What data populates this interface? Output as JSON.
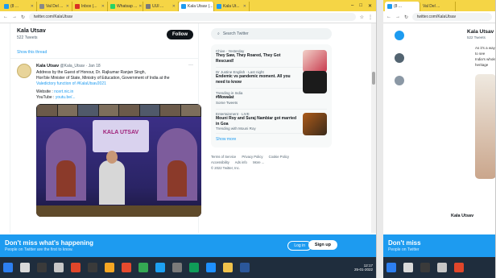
{
  "browser": {
    "tabs": [
      {
        "label": "(8 ..."
      },
      {
        "label": "Val Del ..."
      },
      {
        "label": "Inbox (..."
      },
      {
        "label": "Whatsap ..."
      },
      {
        "label": "UUI ..."
      },
      {
        "label": "Kala Utsav (...",
        "active": true
      },
      {
        "label": "Kala Ut..."
      }
    ],
    "window_controls": [
      "–",
      "□",
      "✕"
    ],
    "url": "twitter.com/KalaUtsav",
    "accent": "#f5d545"
  },
  "profile": {
    "name": "Kala Utsav",
    "subtitle": "522 Tweets",
    "follow_label": "Follow",
    "show_more": "Show this thread"
  },
  "tweet": {
    "author": "Kala Utsav",
    "handle": "@Kala_Utsav · Jan 18",
    "text_line1": "Address by the Guest of Honour, Dr. Rajkumar Ranjan Singh,",
    "text_line2": "Hon'ble Minister of State, Ministry of Education, Government of India at the",
    "text_line3": "Valedictory function of #KalaUtsav2021",
    "link1_label": "Website :",
    "link1": "ncert.nic.in",
    "link2_label": "YouTube :",
    "link2": "youtu.be/...",
    "banner_title": "KALA UTSAV"
  },
  "sidebar": {
    "search_placeholder": "Search Twitter",
    "trends": [
      {
        "meta": "Chive · Yesterday",
        "title": "They Saw, They Roared, They Got Rescued!",
        "sub": ""
      },
      {
        "meta": "Dr Justine English · Last night",
        "title": "Endemic vs pandemic moment. All you need to know",
        "sub": ""
      },
      {
        "meta": "Trending in India",
        "title": "#Mowalat",
        "sub": "Some Tweets"
      },
      {
        "meta": "Entertainment · LIVE",
        "title": "Mouni Roy and Suraj Nambiar got married in Goa",
        "sub": "Trending with Mouni Roy"
      }
    ],
    "show_more": "Show more",
    "footer": [
      "Terms of Service",
      "Privacy Policy",
      "Cookie Policy",
      "Accessibility",
      "Ads info",
      "More ...",
      "© 2022 Twitter, Inc."
    ]
  },
  "cta": {
    "title": "Don't miss what's happening",
    "subtitle": "People on Twitter are the first to know.",
    "login": "Log in",
    "signup": "Sign up"
  },
  "taskbar": {
    "time": "12:17",
    "date": "25-01-2022"
  },
  "side_window": {
    "name": "Kala Utsav",
    "sub": "522 Tweets",
    "text": "As it's a way to see India's whole heritage",
    "bottom_title": "Don't miss",
    "bottom_sub": "People on Twitter"
  }
}
